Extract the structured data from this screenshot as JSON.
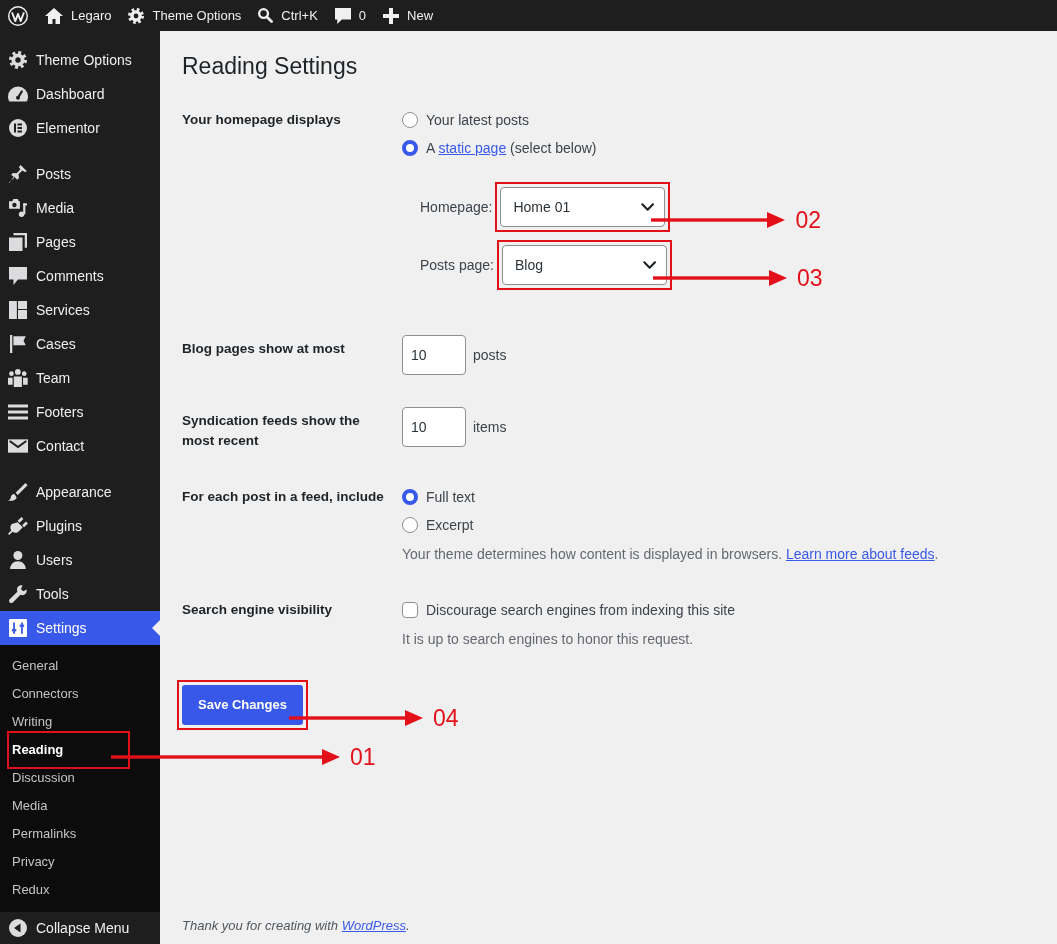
{
  "admin_bar": {
    "items": [
      {
        "label": "Legaro"
      },
      {
        "label": "Theme Options"
      },
      {
        "label": "Ctrl+K"
      },
      {
        "label": "0"
      },
      {
        "label": "New"
      }
    ]
  },
  "sidebar": {
    "groups": [
      {
        "items": [
          {
            "label": "Theme Options",
            "selected": false
          },
          {
            "label": "Dashboard",
            "selected": false
          },
          {
            "label": "Elementor",
            "selected": false
          }
        ]
      },
      {
        "items": [
          {
            "label": "Posts",
            "selected": false
          },
          {
            "label": "Media",
            "selected": false
          },
          {
            "label": "Pages",
            "selected": false
          },
          {
            "label": "Comments",
            "selected": false
          },
          {
            "label": "Services",
            "selected": false
          },
          {
            "label": "Cases",
            "selected": false
          },
          {
            "label": "Team",
            "selected": false
          },
          {
            "label": "Footers",
            "selected": false
          },
          {
            "label": "Contact",
            "selected": false
          }
        ]
      },
      {
        "items": [
          {
            "label": "Appearance",
            "selected": false
          },
          {
            "label": "Plugins",
            "selected": false
          },
          {
            "label": "Users",
            "selected": false
          },
          {
            "label": "Tools",
            "selected": false
          },
          {
            "label": "Settings",
            "selected": true,
            "submenu": [
              {
                "label": "General",
                "selected": false
              },
              {
                "label": "Connectors",
                "selected": false
              },
              {
                "label": "Writing",
                "selected": false
              },
              {
                "label": "Reading",
                "selected": true,
                "annotation": "01"
              },
              {
                "label": "Discussion",
                "selected": false
              },
              {
                "label": "Media",
                "selected": false
              },
              {
                "label": "Permalinks",
                "selected": false
              },
              {
                "label": "Privacy",
                "selected": false
              },
              {
                "label": "Redux",
                "selected": false
              }
            ]
          }
        ]
      }
    ],
    "collapse": {
      "label": "Collapse Menu"
    }
  },
  "page": {
    "title": "Reading Settings",
    "rows": [
      {
        "kind": "radios",
        "label": "Your homepage displays",
        "options": [
          {
            "text": "Your latest posts",
            "selected": false
          },
          {
            "text": "A ",
            "link": "static page",
            "after": " (select below)",
            "selected": true
          }
        ],
        "selects": [
          {
            "label": "Homepage:",
            "value": "Home 01",
            "annotation": "02"
          },
          {
            "label": "Posts page:",
            "value": "Blog",
            "annotation": "03"
          }
        ]
      },
      {
        "kind": "number",
        "label": "Blog pages show at most",
        "value": "10",
        "unit": "posts"
      },
      {
        "kind": "number",
        "label": "Syndication feeds show the most recent",
        "value": "10",
        "unit": "items"
      },
      {
        "kind": "radios",
        "label": "For each post in a feed, include",
        "options": [
          {
            "text": "Full text",
            "selected": true
          },
          {
            "text": "Excerpt",
            "selected": false
          }
        ],
        "description": {
          "text": "Your theme determines how content is displayed in browsers. ",
          "link": "Learn more about feeds",
          "after": "."
        }
      },
      {
        "kind": "checkbox",
        "label": "Search engine visibility",
        "text": "Discourage search engines from indexing this site",
        "checked": false,
        "description": {
          "text": "It is up to search engines to honor this request."
        }
      }
    ],
    "save_button": {
      "label": "Save Changes",
      "annotation": "04"
    },
    "footer": {
      "text": "Thank you for creating with ",
      "link": "WordPress",
      "after": "."
    }
  }
}
